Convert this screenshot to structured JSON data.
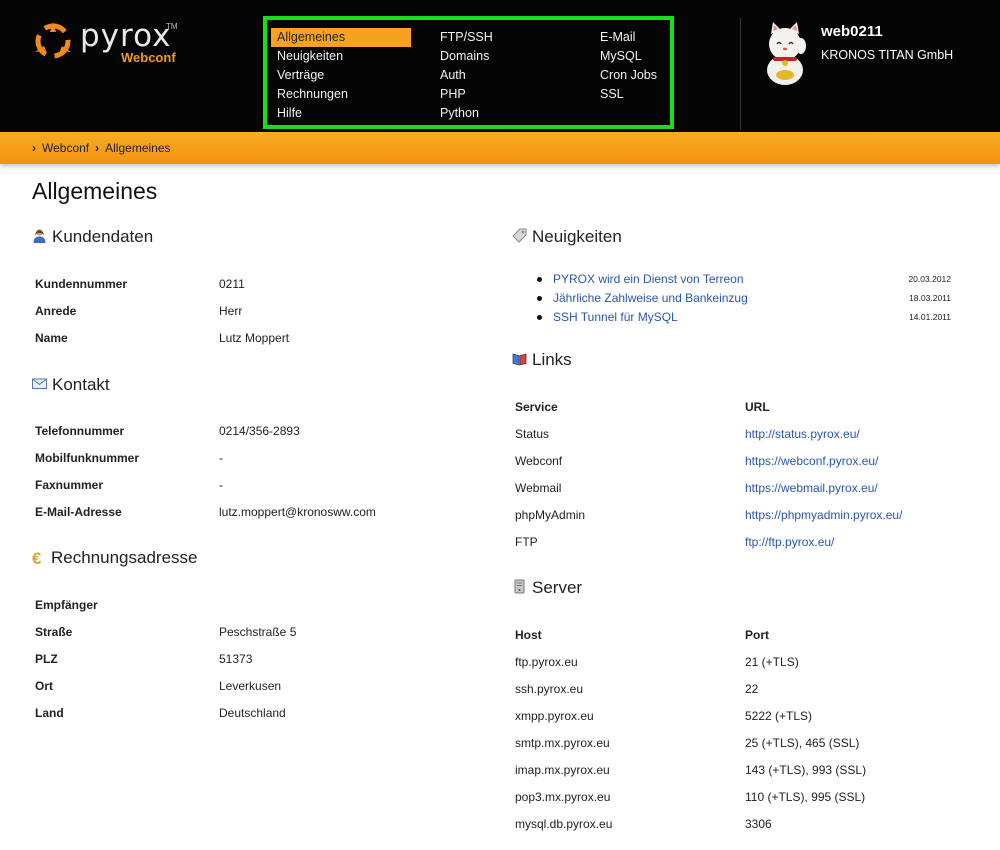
{
  "brand": {
    "name": "pyrox",
    "tm": "TM",
    "product": "Webconf",
    "accent_color": "#f39a1e"
  },
  "nav": {
    "columns": [
      [
        {
          "label": "Allgemeines",
          "active": true
        },
        {
          "label": "Neuigkeiten"
        },
        {
          "label": "Verträge"
        },
        {
          "label": "Rechnungen"
        },
        {
          "label": "Hilfe"
        }
      ],
      [
        {
          "label": "FTP/SSH"
        },
        {
          "label": "Domains"
        },
        {
          "label": "Auth"
        },
        {
          "label": "PHP"
        },
        {
          "label": "Python"
        }
      ],
      [
        {
          "label": "E-Mail"
        },
        {
          "label": "MySQL"
        },
        {
          "label": "Cron Jobs"
        },
        {
          "label": "SSL"
        }
      ]
    ],
    "highlight_color": "#18e018"
  },
  "user": {
    "name": "web0211",
    "company": "KRONOS TITAN GmbH",
    "avatar_icon": "lucky-cat-icon"
  },
  "breadcrumb": [
    "Webconf",
    "Allgemeines"
  ],
  "page": {
    "title": "Allgemeines"
  },
  "kundendaten": {
    "heading": "Kundendaten",
    "icon": "user-icon",
    "rows": [
      [
        "Kundennummer",
        "0211"
      ],
      [
        "Anrede",
        "Herr"
      ],
      [
        "Name",
        "Lutz Moppert"
      ]
    ]
  },
  "kontakt": {
    "heading": "Kontakt",
    "icon": "envelope-icon",
    "rows": [
      [
        "Telefonnummer",
        "0214/356-2893"
      ],
      [
        "Mobilfunknummer",
        "-"
      ],
      [
        "Faxnummer",
        "-"
      ],
      [
        "E-Mail-Adresse",
        "lutz.moppert@kronosww.com"
      ]
    ]
  },
  "rechnungsadresse": {
    "heading": "Rechnungsadresse",
    "icon": "euro-icon",
    "icon_glyph": "€",
    "rows": [
      [
        "Empfänger",
        ""
      ],
      [
        "Straße",
        "Peschstraße 5"
      ],
      [
        "PLZ",
        "51373"
      ],
      [
        "Ort",
        "Leverkusen"
      ],
      [
        "Land",
        "Deutschland"
      ]
    ]
  },
  "neuigkeiten": {
    "heading": "Neuigkeiten",
    "icon": "tag-icon",
    "items": [
      {
        "title": "PYROX wird ein Dienst von Terreon",
        "date": "20.03.2012"
      },
      {
        "title": "Jährliche Zahlweise und Bankeinzug",
        "date": "18.03.2011"
      },
      {
        "title": "SSH Tunnel für MySQL",
        "date": "14.01.2011"
      }
    ]
  },
  "links": {
    "heading": "Links",
    "icon": "book-icon",
    "columns": [
      "Service",
      "URL"
    ],
    "rows": [
      [
        "Status",
        "http://status.pyrox.eu/"
      ],
      [
        "Webconf",
        "https://webconf.pyrox.eu/"
      ],
      [
        "Webmail",
        "https://webmail.pyrox.eu/"
      ],
      [
        "phpMyAdmin",
        "https://phpmyadmin.pyrox.eu/"
      ],
      [
        "FTP",
        "ftp://ftp.pyrox.eu/"
      ]
    ]
  },
  "server": {
    "heading": "Server",
    "icon": "server-icon",
    "columns": [
      "Host",
      "Port"
    ],
    "rows": [
      [
        "ftp.pyrox.eu",
        "21 (+TLS)"
      ],
      [
        "ssh.pyrox.eu",
        "22"
      ],
      [
        "xmpp.pyrox.eu",
        "5222 (+TLS)"
      ],
      [
        "smtp.mx.pyrox.eu",
        "25 (+TLS), 465 (SSL)"
      ],
      [
        "imap.mx.pyrox.eu",
        "143 (+TLS), 993 (SSL)"
      ],
      [
        "pop3.mx.pyrox.eu",
        "110 (+TLS), 995 (SSL)"
      ],
      [
        "mysql.db.pyrox.eu",
        "3306"
      ]
    ]
  }
}
